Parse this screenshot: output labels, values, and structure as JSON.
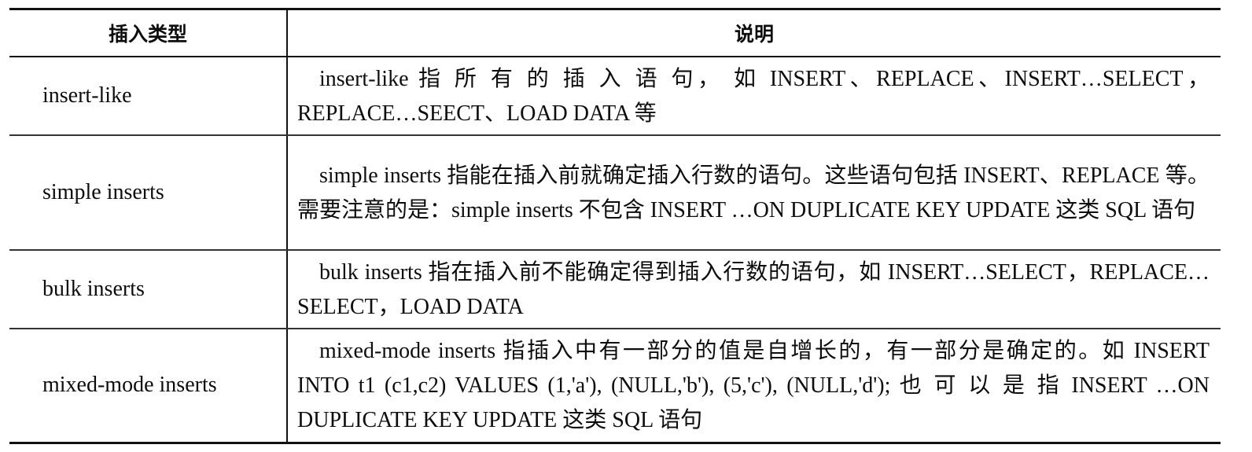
{
  "table": {
    "headers": {
      "type": "插入类型",
      "description": "说明"
    },
    "rows": [
      {
        "type": "insert-like",
        "description": "insert-like 指 所 有 的 插 入 语 句， 如 INSERT、REPLACE、INSERT…SELECT，REPLACE…SEECT、LOAD DATA 等"
      },
      {
        "type": "simple inserts",
        "description": "simple inserts 指能在插入前就确定插入行数的语句。这些语句包括 INSERT、REPLACE 等。需要注意的是：simple inserts 不包含 INSERT …ON DUPLICATE KEY UPDATE 这类 SQL 语句"
      },
      {
        "type": "bulk inserts",
        "description": "bulk inserts 指在插入前不能确定得到插入行数的语句，如 INSERT…SELECT，REPLACE…SELECT，LOAD DATA"
      },
      {
        "type": "mixed-mode inserts",
        "description": "mixed-mode inserts 指插入中有一部分的值是自增长的，有一部分是确定的。如 INSERT INTO t1 (c1,c2) VALUES (1,'a'), (NULL,'b'), (5,'c'), (NULL,'d'); 也 可 以 是 指 INSERT …ON DUPLICATE KEY UPDATE 这类 SQL 语句"
      }
    ]
  }
}
